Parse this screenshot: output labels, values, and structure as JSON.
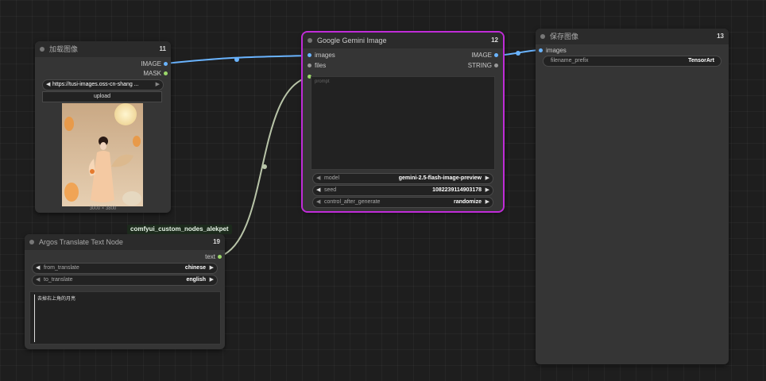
{
  "colors": {
    "image_link": "#6ab4ff",
    "string_link": "#b8c4a8",
    "selection": "#c02cd8",
    "int_pin": "#9cd86a"
  },
  "load_image": {
    "title": "加载图像",
    "id": "11",
    "outputs": [
      "IMAGE",
      "MASK"
    ],
    "image_widget": "https://tusi-images.oss-cn-shang ...",
    "upload_label": "upload",
    "dimensions": "3000 × 3800"
  },
  "gemini": {
    "title": "Google Gemini Image",
    "id": "12",
    "inputs": [
      "images",
      "files"
    ],
    "outputs": [
      "IMAGE",
      "STRING"
    ],
    "prompt_placeholder": "prompt",
    "widgets": [
      {
        "label": "model",
        "value": "gemini-2.5-flash-image-preview"
      },
      {
        "label": "seed",
        "value": "1082239114903178"
      },
      {
        "label": "control_after_generate",
        "value": "randomize"
      }
    ]
  },
  "save_image": {
    "title": "保存图像",
    "id": "13",
    "inputs": [
      "images"
    ],
    "widget": {
      "label": "filename_prefix",
      "value": "TensorArt"
    }
  },
  "translate": {
    "badge": "comfyui_custom_nodes_alekpet",
    "title": "Argos Translate Text Node",
    "id": "19",
    "outputs": [
      "text"
    ],
    "widgets": [
      {
        "label": "from_translate",
        "value": "chinese"
      },
      {
        "label": "to_translate",
        "value": "english"
      }
    ],
    "text": "去掉右上角的月亮"
  }
}
